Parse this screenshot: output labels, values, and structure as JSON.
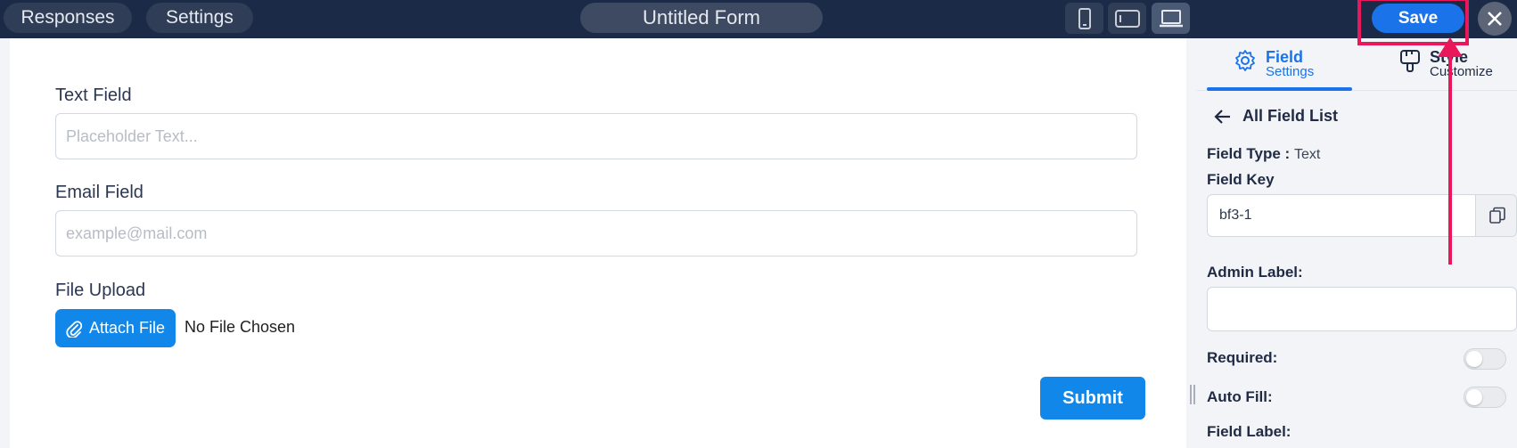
{
  "topbar": {
    "responses_label": "Responses",
    "settings_label": "Settings",
    "form_title": "Untitled Form",
    "save_label": "Save",
    "active_device": "desktop"
  },
  "form": {
    "text_field": {
      "label": "Text Field",
      "placeholder": "Placeholder Text..."
    },
    "email_field": {
      "label": "Email Field",
      "placeholder": "example@mail.com"
    },
    "file_upload": {
      "label": "File Upload",
      "button_label": "Attach File",
      "status": "No File Chosen"
    },
    "submit_label": "Submit"
  },
  "panel": {
    "tabs": [
      {
        "title": "Field",
        "subtitle": "Settings",
        "icon": "gear-icon",
        "active": true
      },
      {
        "title": "Style",
        "subtitle": "Customize",
        "icon": "brush-icon",
        "active": false
      }
    ],
    "back_label": "All Field List",
    "field_type_label": "Field Type :",
    "field_type_value": "Text",
    "field_key_label": "Field Key",
    "field_key_value": "bf3-1",
    "admin_label": "Admin Label:",
    "admin_value": "",
    "required_label": "Required:",
    "required_on": false,
    "autofill_label": "Auto Fill:",
    "autofill_on": false,
    "field_label_label": "Field Label:"
  },
  "colors": {
    "topbar": "#1b2a47",
    "accent": "#1a73e8",
    "highlight": "#e8185a",
    "panel_bg": "#f3f4f7"
  }
}
